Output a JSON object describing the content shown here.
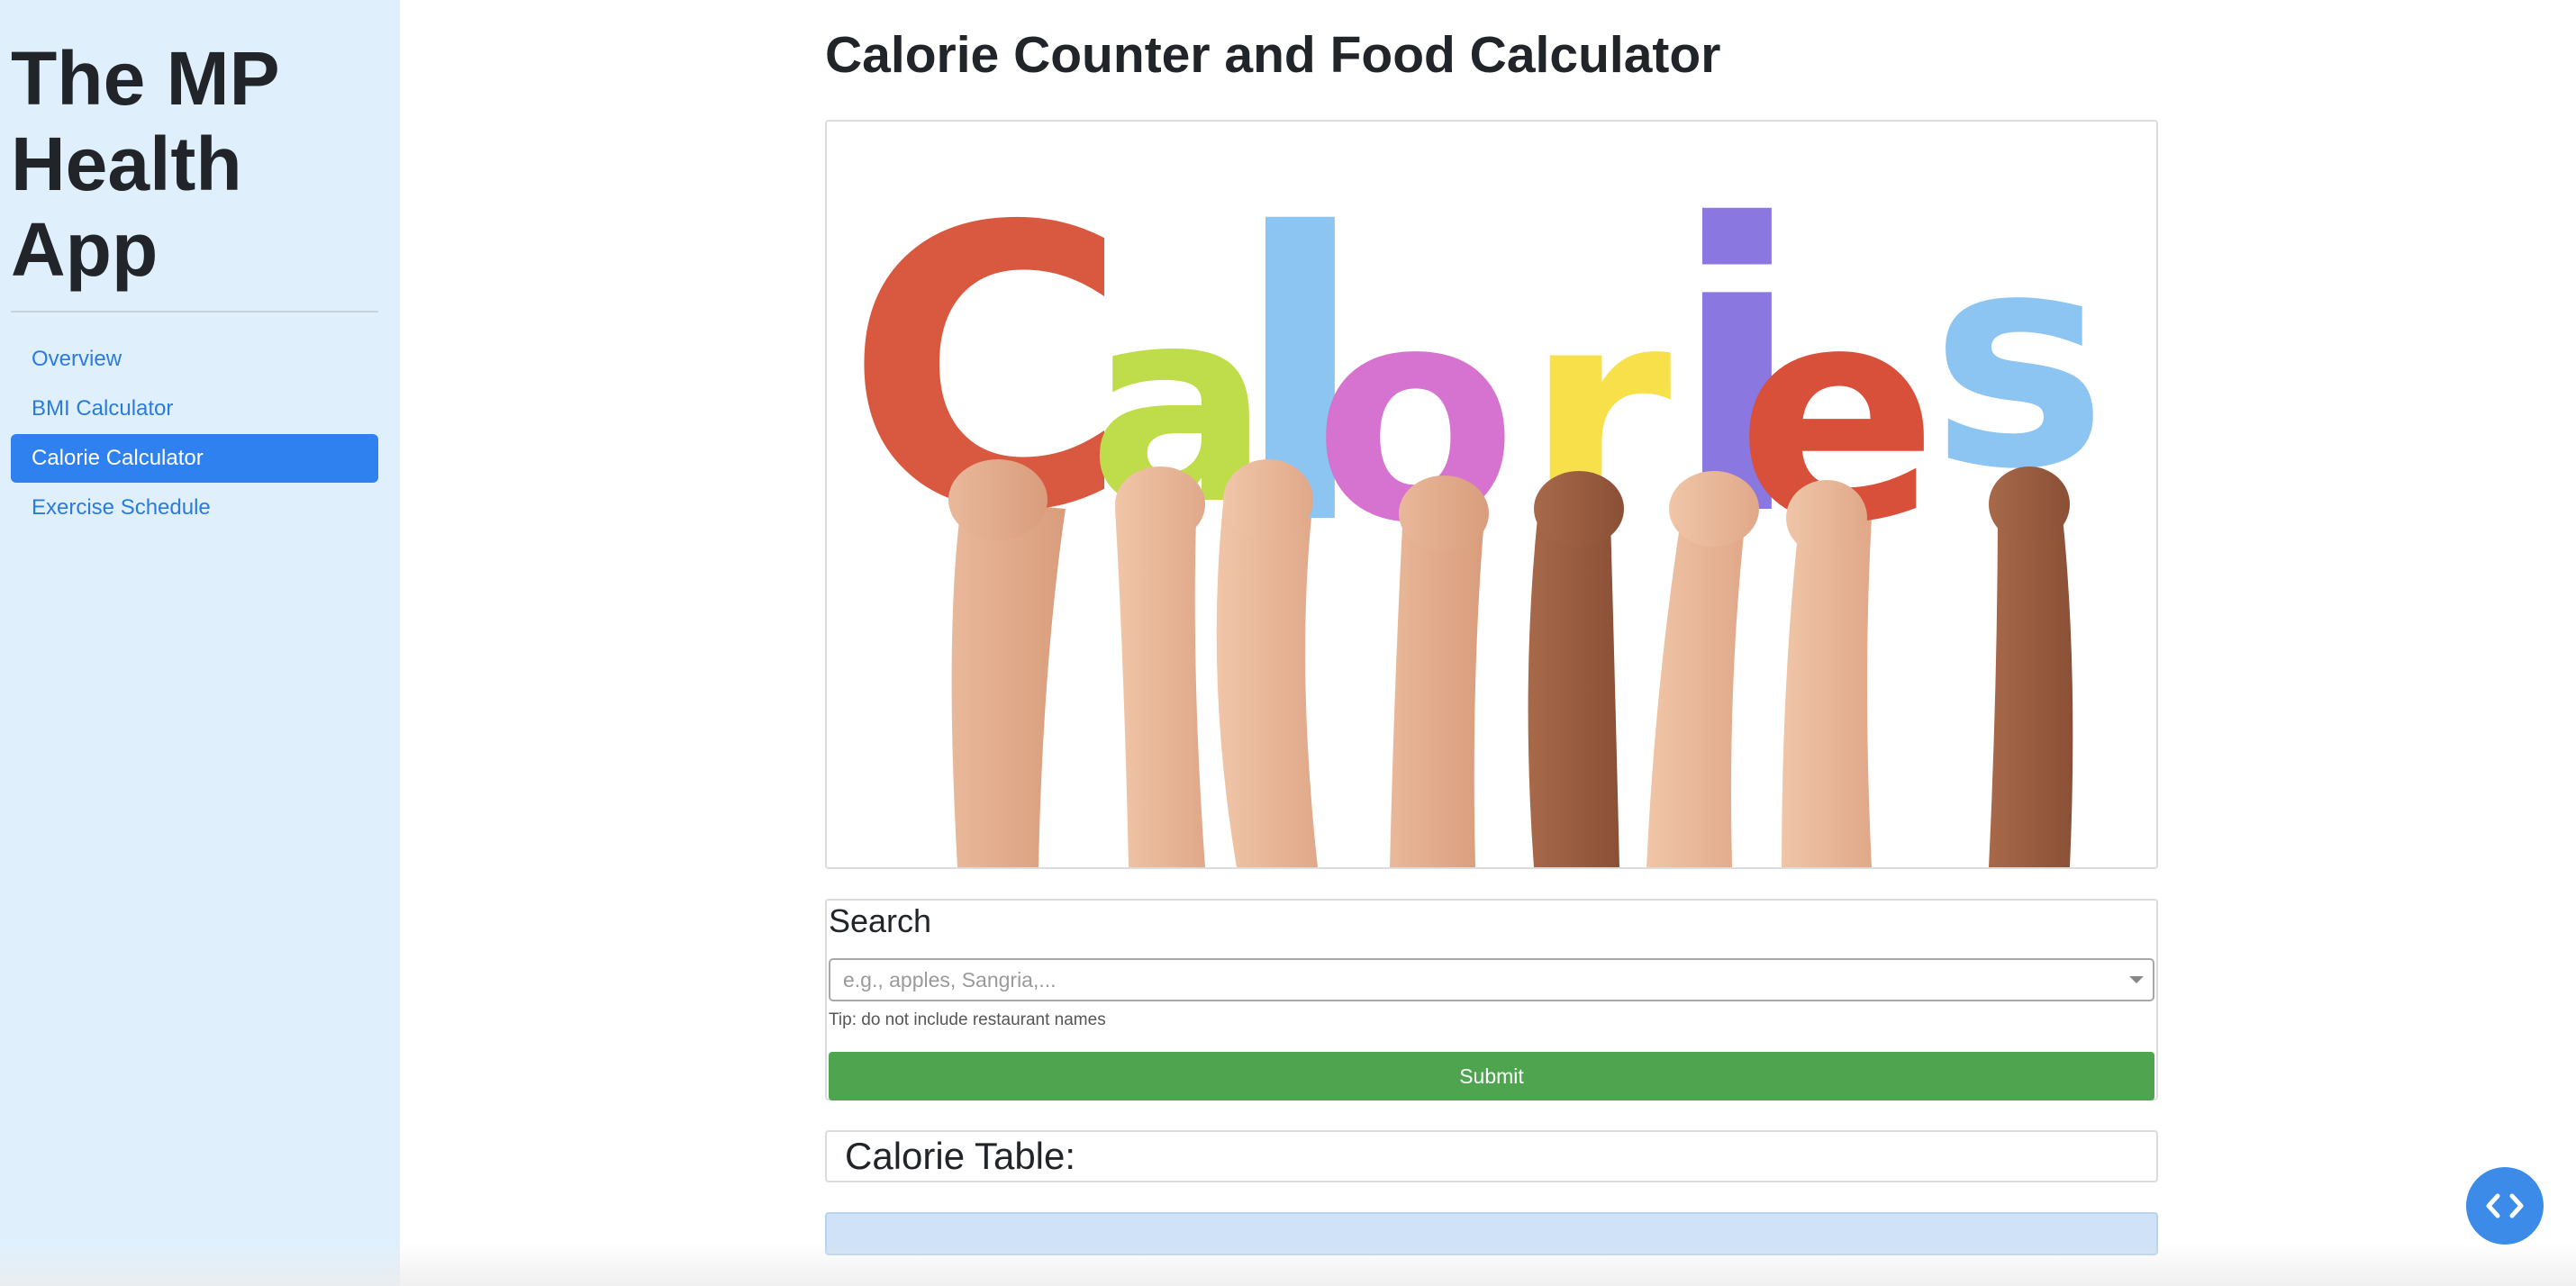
{
  "sidebar": {
    "app_title": "The MP Health App",
    "items": [
      {
        "label": "Overview",
        "active": false
      },
      {
        "label": "BMI Calculator",
        "active": false
      },
      {
        "label": "Calorie Calculator",
        "active": true
      },
      {
        "label": "Exercise Schedule",
        "active": false
      }
    ]
  },
  "main": {
    "title": "Calorie Counter and Food Calculator",
    "hero": {
      "word": "Calories",
      "letter_colors": [
        "#d95840",
        "#bfdc4a",
        "#8cc4f2",
        "#d672cf",
        "#f7e04a",
        "#8a77e0",
        "#d84f3a",
        "#8cc4f2"
      ]
    },
    "search": {
      "heading": "Search",
      "placeholder": "e.g., apples, Sangria,...",
      "tip": "Tip: do not include restaurant names",
      "submit_label": "Submit"
    },
    "table": {
      "heading": "Calorie Table:"
    }
  },
  "colors": {
    "sidebar_bg": "#dff0fc",
    "accent": "#2f81ef",
    "submit": "#4fa54f",
    "fab": "#3d8be8"
  },
  "icons": {
    "fab": "code-brackets-icon",
    "dropdown": "chevron-down-icon"
  }
}
